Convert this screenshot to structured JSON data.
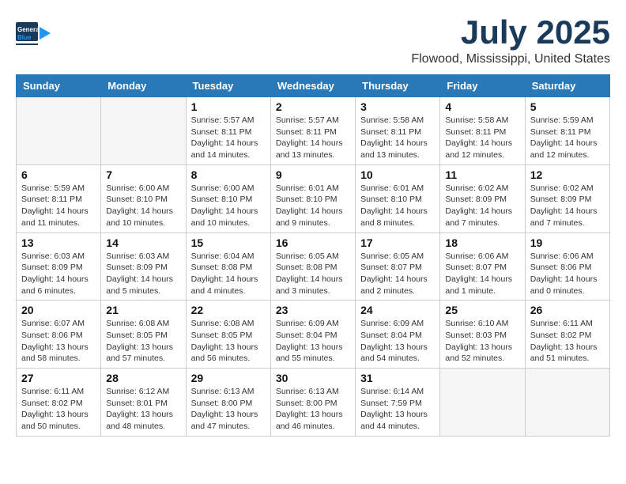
{
  "header": {
    "logo_general": "General",
    "logo_blue": "Blue",
    "month": "July 2025",
    "location": "Flowood, Mississippi, United States"
  },
  "days_of_week": [
    "Sunday",
    "Monday",
    "Tuesday",
    "Wednesday",
    "Thursday",
    "Friday",
    "Saturday"
  ],
  "weeks": [
    [
      {
        "day": "",
        "info": ""
      },
      {
        "day": "",
        "info": ""
      },
      {
        "day": "1",
        "info": "Sunrise: 5:57 AM\nSunset: 8:11 PM\nDaylight: 14 hours and 14 minutes."
      },
      {
        "day": "2",
        "info": "Sunrise: 5:57 AM\nSunset: 8:11 PM\nDaylight: 14 hours and 13 minutes."
      },
      {
        "day": "3",
        "info": "Sunrise: 5:58 AM\nSunset: 8:11 PM\nDaylight: 14 hours and 13 minutes."
      },
      {
        "day": "4",
        "info": "Sunrise: 5:58 AM\nSunset: 8:11 PM\nDaylight: 14 hours and 12 minutes."
      },
      {
        "day": "5",
        "info": "Sunrise: 5:59 AM\nSunset: 8:11 PM\nDaylight: 14 hours and 12 minutes."
      }
    ],
    [
      {
        "day": "6",
        "info": "Sunrise: 5:59 AM\nSunset: 8:11 PM\nDaylight: 14 hours and 11 minutes."
      },
      {
        "day": "7",
        "info": "Sunrise: 6:00 AM\nSunset: 8:10 PM\nDaylight: 14 hours and 10 minutes."
      },
      {
        "day": "8",
        "info": "Sunrise: 6:00 AM\nSunset: 8:10 PM\nDaylight: 14 hours and 10 minutes."
      },
      {
        "day": "9",
        "info": "Sunrise: 6:01 AM\nSunset: 8:10 PM\nDaylight: 14 hours and 9 minutes."
      },
      {
        "day": "10",
        "info": "Sunrise: 6:01 AM\nSunset: 8:10 PM\nDaylight: 14 hours and 8 minutes."
      },
      {
        "day": "11",
        "info": "Sunrise: 6:02 AM\nSunset: 8:09 PM\nDaylight: 14 hours and 7 minutes."
      },
      {
        "day": "12",
        "info": "Sunrise: 6:02 AM\nSunset: 8:09 PM\nDaylight: 14 hours and 7 minutes."
      }
    ],
    [
      {
        "day": "13",
        "info": "Sunrise: 6:03 AM\nSunset: 8:09 PM\nDaylight: 14 hours and 6 minutes."
      },
      {
        "day": "14",
        "info": "Sunrise: 6:03 AM\nSunset: 8:09 PM\nDaylight: 14 hours and 5 minutes."
      },
      {
        "day": "15",
        "info": "Sunrise: 6:04 AM\nSunset: 8:08 PM\nDaylight: 14 hours and 4 minutes."
      },
      {
        "day": "16",
        "info": "Sunrise: 6:05 AM\nSunset: 8:08 PM\nDaylight: 14 hours and 3 minutes."
      },
      {
        "day": "17",
        "info": "Sunrise: 6:05 AM\nSunset: 8:07 PM\nDaylight: 14 hours and 2 minutes."
      },
      {
        "day": "18",
        "info": "Sunrise: 6:06 AM\nSunset: 8:07 PM\nDaylight: 14 hours and 1 minute."
      },
      {
        "day": "19",
        "info": "Sunrise: 6:06 AM\nSunset: 8:06 PM\nDaylight: 14 hours and 0 minutes."
      }
    ],
    [
      {
        "day": "20",
        "info": "Sunrise: 6:07 AM\nSunset: 8:06 PM\nDaylight: 13 hours and 58 minutes."
      },
      {
        "day": "21",
        "info": "Sunrise: 6:08 AM\nSunset: 8:05 PM\nDaylight: 13 hours and 57 minutes."
      },
      {
        "day": "22",
        "info": "Sunrise: 6:08 AM\nSunset: 8:05 PM\nDaylight: 13 hours and 56 minutes."
      },
      {
        "day": "23",
        "info": "Sunrise: 6:09 AM\nSunset: 8:04 PM\nDaylight: 13 hours and 55 minutes."
      },
      {
        "day": "24",
        "info": "Sunrise: 6:09 AM\nSunset: 8:04 PM\nDaylight: 13 hours and 54 minutes."
      },
      {
        "day": "25",
        "info": "Sunrise: 6:10 AM\nSunset: 8:03 PM\nDaylight: 13 hours and 52 minutes."
      },
      {
        "day": "26",
        "info": "Sunrise: 6:11 AM\nSunset: 8:02 PM\nDaylight: 13 hours and 51 minutes."
      }
    ],
    [
      {
        "day": "27",
        "info": "Sunrise: 6:11 AM\nSunset: 8:02 PM\nDaylight: 13 hours and 50 minutes."
      },
      {
        "day": "28",
        "info": "Sunrise: 6:12 AM\nSunset: 8:01 PM\nDaylight: 13 hours and 48 minutes."
      },
      {
        "day": "29",
        "info": "Sunrise: 6:13 AM\nSunset: 8:00 PM\nDaylight: 13 hours and 47 minutes."
      },
      {
        "day": "30",
        "info": "Sunrise: 6:13 AM\nSunset: 8:00 PM\nDaylight: 13 hours and 46 minutes."
      },
      {
        "day": "31",
        "info": "Sunrise: 6:14 AM\nSunset: 7:59 PM\nDaylight: 13 hours and 44 minutes."
      },
      {
        "day": "",
        "info": ""
      },
      {
        "day": "",
        "info": ""
      }
    ]
  ]
}
